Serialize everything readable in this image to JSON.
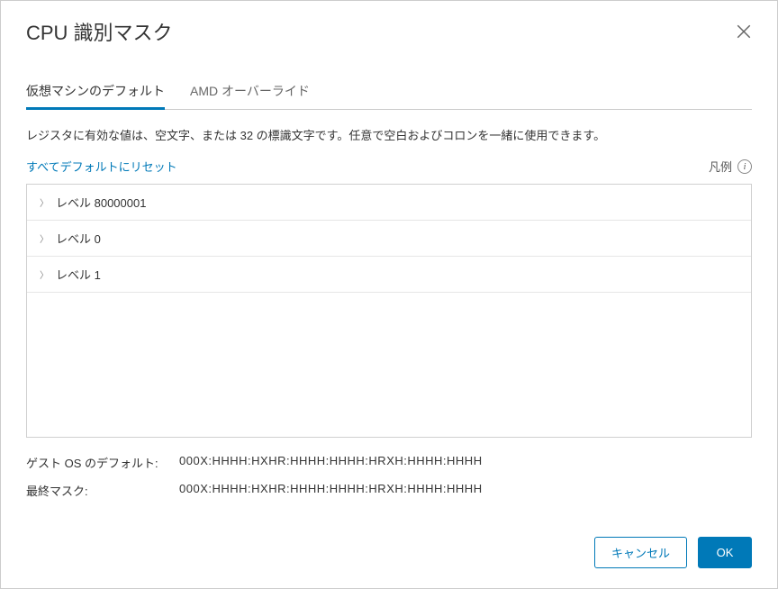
{
  "header": {
    "title": "CPU 識別マスク"
  },
  "tabs": {
    "items": [
      {
        "label": "仮想マシンのデフォルト",
        "active": true
      },
      {
        "label": "AMD オーバーライド",
        "active": false
      }
    ]
  },
  "description": "レジスタに有効な値は、空文字、または 32 の標識文字です。任意で空白およびコロンを一緒に使用できます。",
  "toolbar": {
    "reset_label": "すべてデフォルトにリセット",
    "legend_label": "凡例"
  },
  "levels": [
    {
      "label": "レベル 80000001"
    },
    {
      "label": "レベル 0"
    },
    {
      "label": "レベル 1"
    }
  ],
  "summary": {
    "guest_default_label": "ゲスト OS のデフォルト:",
    "guest_default_value": "000X:HHHH:HXHR:HHHH:HHHH:HRXH:HHHH:HHHH",
    "final_mask_label": "最終マスク:",
    "final_mask_value": "000X:HHHH:HXHR:HHHH:HHHH:HRXH:HHHH:HHHH"
  },
  "footer": {
    "cancel_label": "キャンセル",
    "ok_label": "OK"
  }
}
